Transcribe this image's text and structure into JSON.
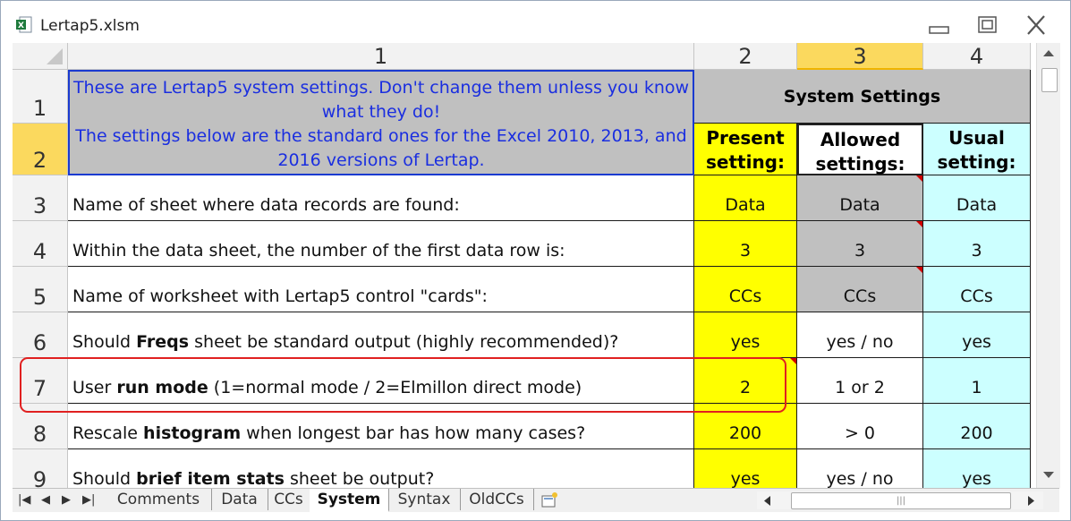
{
  "window": {
    "title": "Lertap5.xlsm"
  },
  "columns": [
    {
      "label": "1",
      "selected": false
    },
    {
      "label": "2",
      "selected": false
    },
    {
      "label": "3",
      "selected": true
    },
    {
      "label": "4",
      "selected": false
    }
  ],
  "row_headers": [
    "1",
    "2",
    "3",
    "4",
    "5",
    "6",
    "7",
    "8",
    "9"
  ],
  "note": {
    "line1": "These are Lertap5 system settings. Don't change them unless you know what they do!",
    "line2": "The settings below are the standard ones for the Excel 2010, 2013, and 2016 versions of Lertap."
  },
  "system_header": "System Settings",
  "subheaders": {
    "present": "Present setting:",
    "allowed": "Allowed settings:",
    "usual": "Usual setting:"
  },
  "rows": [
    {
      "pre": "Name of sheet where data records are found:",
      "bold": "",
      "post": "",
      "present": "Data",
      "allowed": "Data",
      "usual": "Data"
    },
    {
      "pre": "Within the data sheet, the number of the first data row is:",
      "bold": "",
      "post": "",
      "present": "3",
      "allowed": "3",
      "usual": "3"
    },
    {
      "pre": "Name of worksheet with Lertap5 control \"cards\":",
      "bold": "",
      "post": "",
      "present": "CCs",
      "allowed": "CCs",
      "usual": "CCs"
    },
    {
      "pre": "Should ",
      "bold": "Freqs",
      "post": " sheet be standard output (highly recommended)?",
      "present": "yes",
      "allowed": "yes / no",
      "usual": "yes"
    },
    {
      "pre": "User ",
      "bold": "run mode",
      "post": " (1=normal mode / 2=Elmillon direct mode)",
      "present": "2",
      "allowed": "1 or 2",
      "usual": "1"
    },
    {
      "pre": "Rescale ",
      "bold": "histogram",
      "post": " when longest bar has how many cases?",
      "present": "200",
      "allowed": "> 0",
      "usual": "200"
    },
    {
      "pre": "Should ",
      "bold": "brief item stats",
      "post": " sheet be output?",
      "present": "yes",
      "allowed": "yes / no",
      "usual": "yes"
    }
  ],
  "sheet_tabs": [
    {
      "label": "Comments",
      "active": false
    },
    {
      "label": "Data",
      "active": false
    },
    {
      "label": "CCs",
      "active": false
    },
    {
      "label": "System",
      "active": true
    },
    {
      "label": "Syntax",
      "active": false
    },
    {
      "label": "OldCCs",
      "active": false
    }
  ],
  "colors": {
    "present": "#ffff00",
    "allowed": "#c0c0c0",
    "usual": "#ccffff",
    "note_text": "#1a2ee0",
    "highlight": "#e02020"
  }
}
